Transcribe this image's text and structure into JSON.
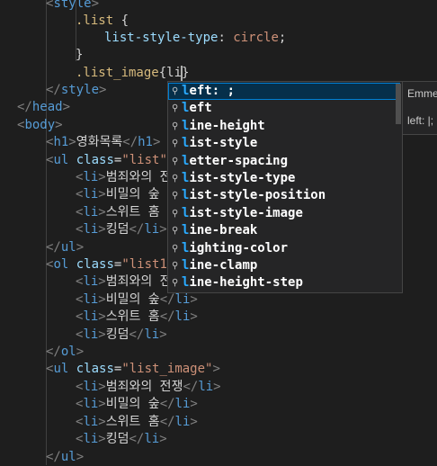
{
  "code": {
    "l0": "<style>",
    "l1_sel": ".list",
    "l2_prop": "list-style-type",
    "l2_val": "circle",
    "l4_typed": ".list_image{li}",
    "l5": "</style>",
    "l6": "</head>",
    "l7": "<body>",
    "h1_text": "영화목록",
    "ul_class": "\"list\"",
    "ol_class": "\"list1\"",
    "ul2_class": "\"list_image\"",
    "li1": "범죄와의 전쟁",
    "li2": "비밀의 숲",
    "li3": "스위트 홈",
    "li4": "킹덤"
  },
  "suggest": {
    "items": [
      {
        "prefix": "l",
        "label": "left: ;"
      },
      {
        "prefix": "l",
        "label": "left"
      },
      {
        "prefix": "l",
        "label": "line-height"
      },
      {
        "prefix": "l",
        "label": "list-style"
      },
      {
        "prefix": "l",
        "label": "letter-spacing"
      },
      {
        "prefix": "l",
        "label": "list-style-type"
      },
      {
        "prefix": "l",
        "label": "list-style-position"
      },
      {
        "prefix": "l",
        "label": "list-style-image"
      },
      {
        "prefix": "l",
        "label": "line-break"
      },
      {
        "prefix": "l",
        "label": "lighting-color"
      },
      {
        "prefix": "l",
        "label": "line-clamp"
      },
      {
        "prefix": "l",
        "label": "line-height-step"
      }
    ],
    "icon": "wrench-icon"
  },
  "details": {
    "title": "Emmet",
    "preview": "left: |;"
  }
}
